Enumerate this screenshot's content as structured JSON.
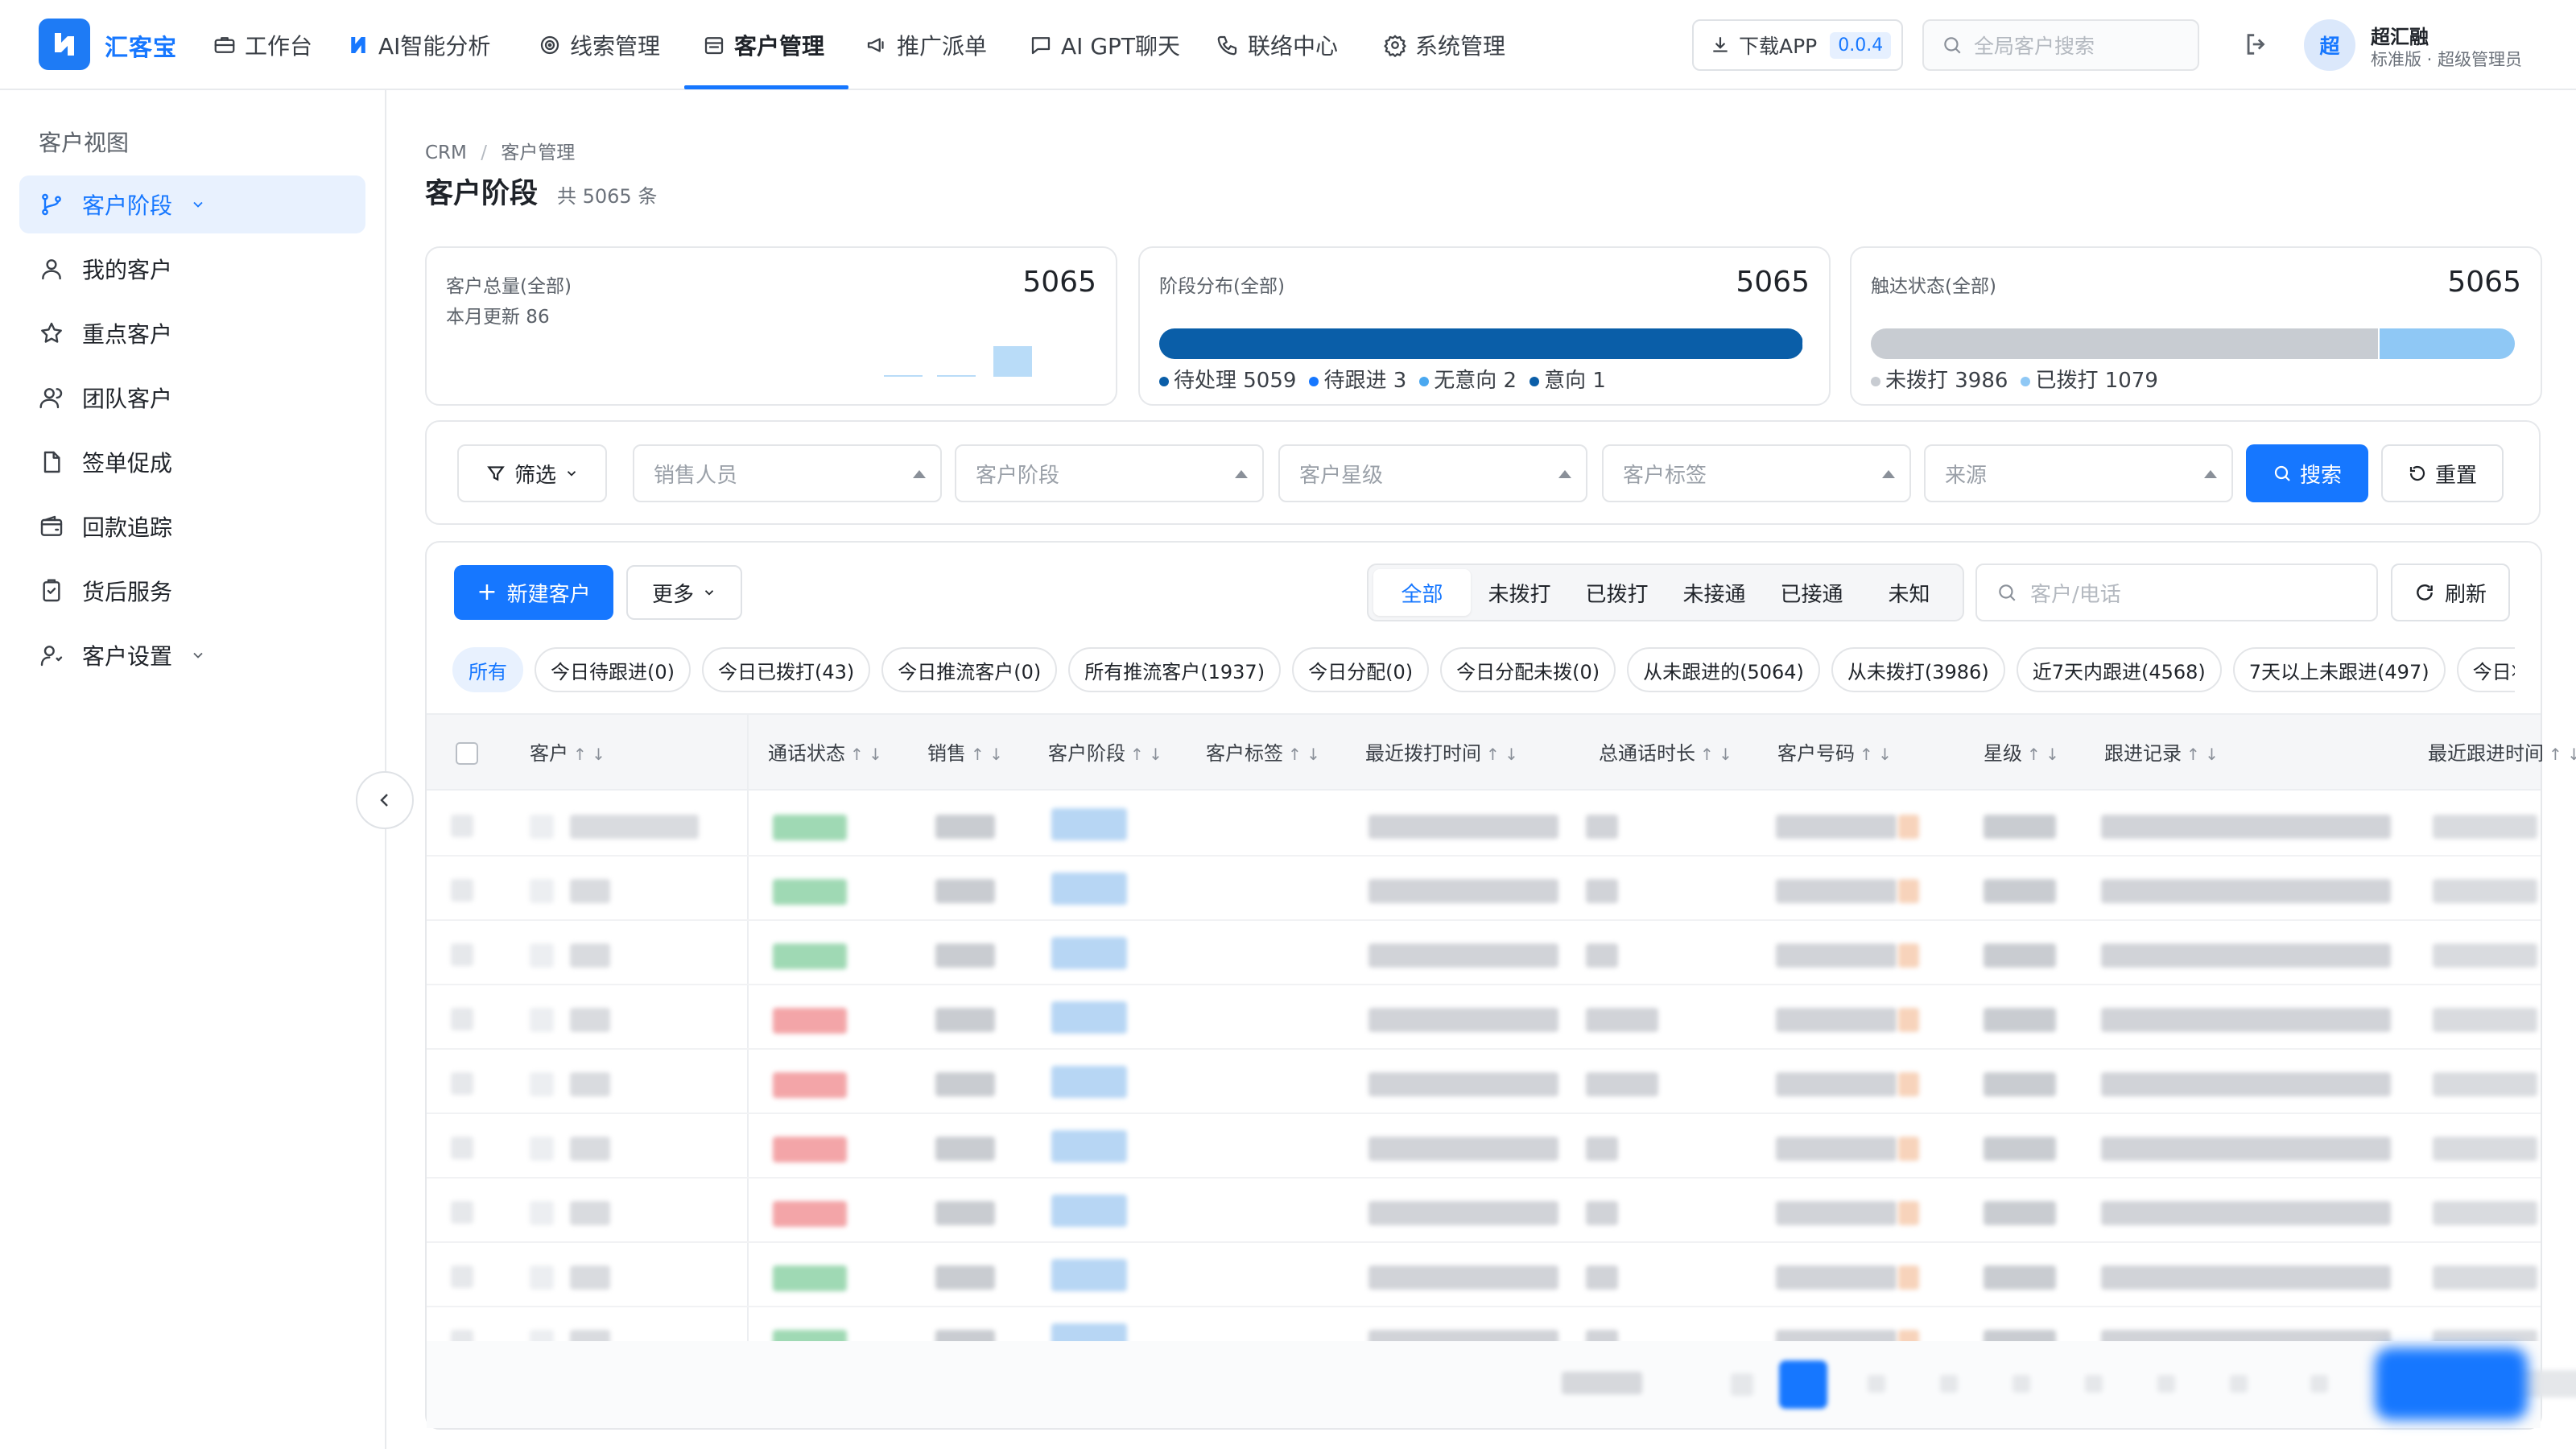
{
  "app": {
    "brand": "汇客宝"
  },
  "nav": {
    "items": [
      {
        "label": "工作台",
        "icon": "briefcase-icon"
      },
      {
        "label": "AI智能分析",
        "icon": "ai-logo-icon"
      },
      {
        "label": "线索管理",
        "icon": "target-icon"
      },
      {
        "label": "客户管理",
        "icon": "calendar-icon",
        "active": true
      },
      {
        "label": "推广派单",
        "icon": "megaphone-icon"
      },
      {
        "label": "AI GPT聊天",
        "icon": "chat-icon"
      },
      {
        "label": "联络中心",
        "icon": "phone-icon"
      },
      {
        "label": "系统管理",
        "icon": "gear-icon"
      }
    ],
    "download_label": "下载APP",
    "version": "0.0.4",
    "search_placeholder": "全局客户搜索",
    "user": {
      "avatar_char": "超",
      "name": "超汇融",
      "role": "标准版 · 超级管理员"
    }
  },
  "sidebar": {
    "title": "客户视图",
    "items": [
      {
        "label": "客户阶段",
        "icon": "branch-icon",
        "active": true,
        "expandable": true
      },
      {
        "label": "我的客户",
        "icon": "user-icon"
      },
      {
        "label": "重点客户",
        "icon": "star-icon"
      },
      {
        "label": "团队客户",
        "icon": "team-icon"
      },
      {
        "label": "签单促成",
        "icon": "document-icon"
      },
      {
        "label": "回款追踪",
        "icon": "wallet-icon"
      },
      {
        "label": "货后服务",
        "icon": "clipboard-icon"
      },
      {
        "label": "客户设置",
        "icon": "user-settings-icon",
        "expandable": true
      }
    ]
  },
  "page": {
    "breadcrumb": [
      "CRM",
      "客户管理"
    ],
    "title": "客户阶段",
    "total": "共 5065 条"
  },
  "stats": {
    "total_card": {
      "label": "客户总量(全部)",
      "value": "5065",
      "sub": "本月更新 86"
    },
    "stage_card": {
      "label": "阶段分布(全部)",
      "value": "5065",
      "legend": [
        {
          "label": "待处理 5059",
          "count": 5059,
          "color": "#0a5ea8"
        },
        {
          "label": "待跟进 3",
          "count": 3,
          "color": "#1677ff"
        },
        {
          "label": "无意向 2",
          "count": 2,
          "color": "#4aa8f0"
        },
        {
          "label": "意向 1",
          "count": 1,
          "color": "#0a5ea8"
        }
      ]
    },
    "reach_card": {
      "label": "触达状态(全部)",
      "value": "5065",
      "legend": [
        {
          "label": "未拨打 3986",
          "count": 3986,
          "color": "#c8ccd2"
        },
        {
          "label": "已拨打 1079",
          "count": 1079,
          "color": "#8fc8f5"
        }
      ]
    }
  },
  "filters": {
    "filter_label": "筛选",
    "selects": [
      "销售人员",
      "客户阶段",
      "客户星级",
      "客户标签",
      "来源"
    ],
    "search_label": "搜索",
    "reset_label": "重置"
  },
  "toolbar": {
    "new_label": "新建客户",
    "more_label": "更多",
    "segments": [
      "全部",
      "未拨打",
      "已拨打",
      "未接通",
      "已接通",
      "未知"
    ],
    "search_placeholder": "客户/电话",
    "refresh_label": "刷新"
  },
  "chips": [
    "所有",
    "今日待跟进(0)",
    "今日已拨打(43)",
    "今日推流客户(0)",
    "所有推流客户(1937)",
    "今日分配(0)",
    "今日分配未拨(0)",
    "从未跟进的(5064)",
    "从未拨打(3986)",
    "近7天内跟进(4568)",
    "7天以上未跟进(497)",
    "今日将回"
  ],
  "table": {
    "columns": [
      "客户",
      "通话状态",
      "销售",
      "客户阶段",
      "客户标签",
      "最近拨打时间",
      "总通话时长",
      "客户号码",
      "星级",
      "跟进记录",
      "最近跟进时间"
    ],
    "status_colors": [
      "green",
      "green",
      "green",
      "red",
      "red",
      "red",
      "red",
      "green",
      "green"
    ]
  },
  "colors": {
    "primary": "#1677ff",
    "bar_dark": "#0a5ea8",
    "bar_grey": "#c8ccd2",
    "bar_light": "#8fc8f5"
  }
}
